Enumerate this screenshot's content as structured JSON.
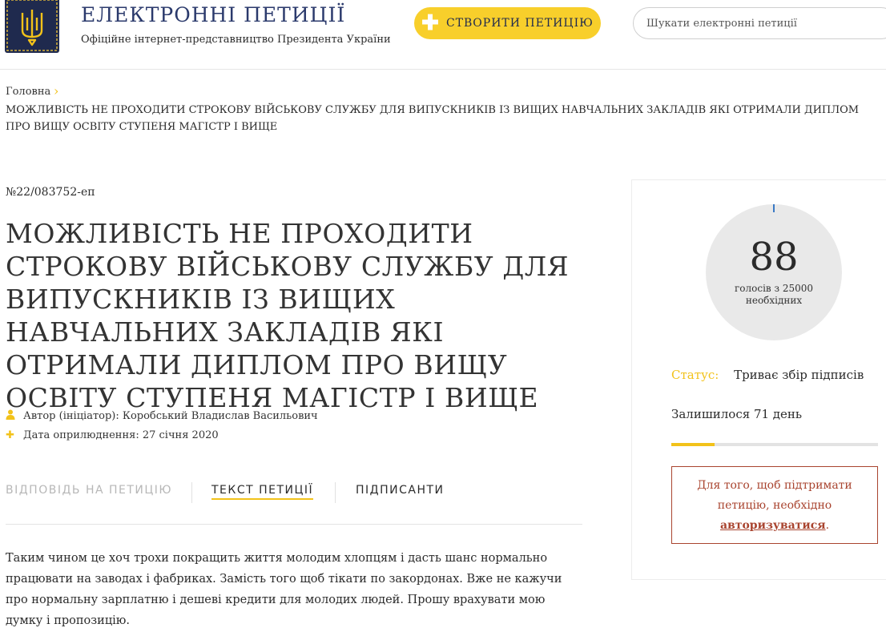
{
  "header": {
    "title": "ЕЛЕКТРОННІ ПЕТИЦІЇ",
    "subtitle": "Офіційне інтернет-представництво Президента України",
    "create_label": "СТВОРИТИ ПЕТИЦІЮ",
    "search_placeholder": "Шукати електронні петиції"
  },
  "breadcrumb": {
    "home": "Головна",
    "current": "МОЖЛИВІСТЬ НЕ ПРОХОДИТИ СТРОКОВУ ВІЙСЬКОВУ СЛУЖБУ ДЛЯ ВИПУСКНИКІВ ІЗ ВИЩИХ НАВЧАЛЬНИХ ЗАКЛАДІВ ЯКІ ОТРИМАЛИ ДИПЛОМ ПРО ВИЩУ ОСВІТУ СТУПЕНЯ МАГІСТР І ВИЩЕ"
  },
  "petition": {
    "number": "№22/083752-еп",
    "title": "МОЖЛИВІСТЬ НЕ ПРОХОДИТИ СТРОКОВУ ВІЙСЬКОВУ СЛУЖБУ ДЛЯ ВИПУСКНИКІВ ІЗ ВИЩИХ НАВЧАЛЬНИХ ЗАКЛАДІВ ЯКІ ОТРИМАЛИ ДИПЛОМ ПРО ВИЩУ ОСВІТУ СТУПЕНЯ МАГІСТР І ВИЩЕ",
    "author": "Автор (ініціатор): Коробський Владислав Васильович",
    "date": "Дата оприлюднення: 27 січня 2020",
    "text": "Таким чином це хоч трохи покращить життя молодим хлопцям і дасть шанс нормально працювати на заводах і фабриках. Замість того щоб тікати по закордонах. Вже не кажучи про нормальну зарплатню і дешеві кредити для молодих людей. Прошу врахувати мою думку і пропозицію."
  },
  "tabs": {
    "answer": "ВІДПОВІДЬ НА ПЕТИЦІЮ",
    "text": "ТЕКСТ ПЕТИЦІЇ",
    "signers": "ПІДПИСАНТИ"
  },
  "sidebar": {
    "votes": "88",
    "votes_label": "голосів з 25000 необхідних",
    "status_label": "Статус:",
    "status_value": "Триває збір підписів",
    "remaining": "Залишилося 71 день",
    "progress_fraction": 0.21,
    "auth_text_before": "Для того, щоб підтримати петицію, необхідно",
    "auth_link": "авторизуватися",
    "auth_text_after": "."
  },
  "colors": {
    "accent": "#f8cf2b",
    "brand_navy": "#1f2a4e",
    "alert": "#a9442f"
  },
  "icons": {
    "logo": "trident-coat-of-arms",
    "create": "plus-icon",
    "breadcrumb_sep": "chevron-right-icon",
    "author": "user-icon",
    "date": "plus-icon"
  }
}
